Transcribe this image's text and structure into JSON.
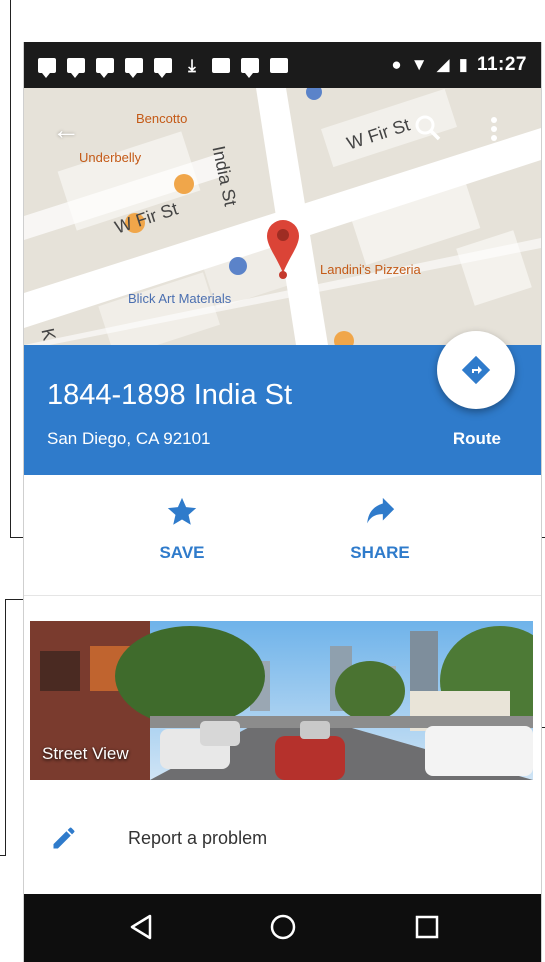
{
  "status_bar": {
    "time": "11:27"
  },
  "map": {
    "labels": {
      "bencotto": "Bencotto",
      "underbelly": "Underbelly",
      "india_st": "India St",
      "w_fir_st_left": "W Fir St",
      "w_fir_st_right": "W Fir St",
      "landinis": "Landini's Pizzeria",
      "blick": "Blick Art Materials",
      "k_fragment": "K"
    }
  },
  "place": {
    "address": "1844-1898 India St",
    "city": "San Diego, CA 92101",
    "route_label": "Route"
  },
  "actions": {
    "save_label": "SAVE",
    "share_label": "SHARE"
  },
  "street_view": {
    "label": "Street View"
  },
  "report": {
    "label": "Report a problem"
  },
  "colors": {
    "accent_blue": "#2f7bcb",
    "status_bar": "#1b1b1b",
    "nav_bar": "#0e0e0e",
    "pin_red": "#db4437"
  },
  "icons": {
    "back": "back-arrow-icon",
    "search": "search-icon",
    "more": "more-vert-icon",
    "directions": "directions-icon",
    "save": "star-icon",
    "share": "share-arrow-icon",
    "report": "pencil-icon",
    "nav_back": "nav-back-icon",
    "nav_home": "nav-home-icon",
    "nav_recents": "nav-recents-icon"
  }
}
